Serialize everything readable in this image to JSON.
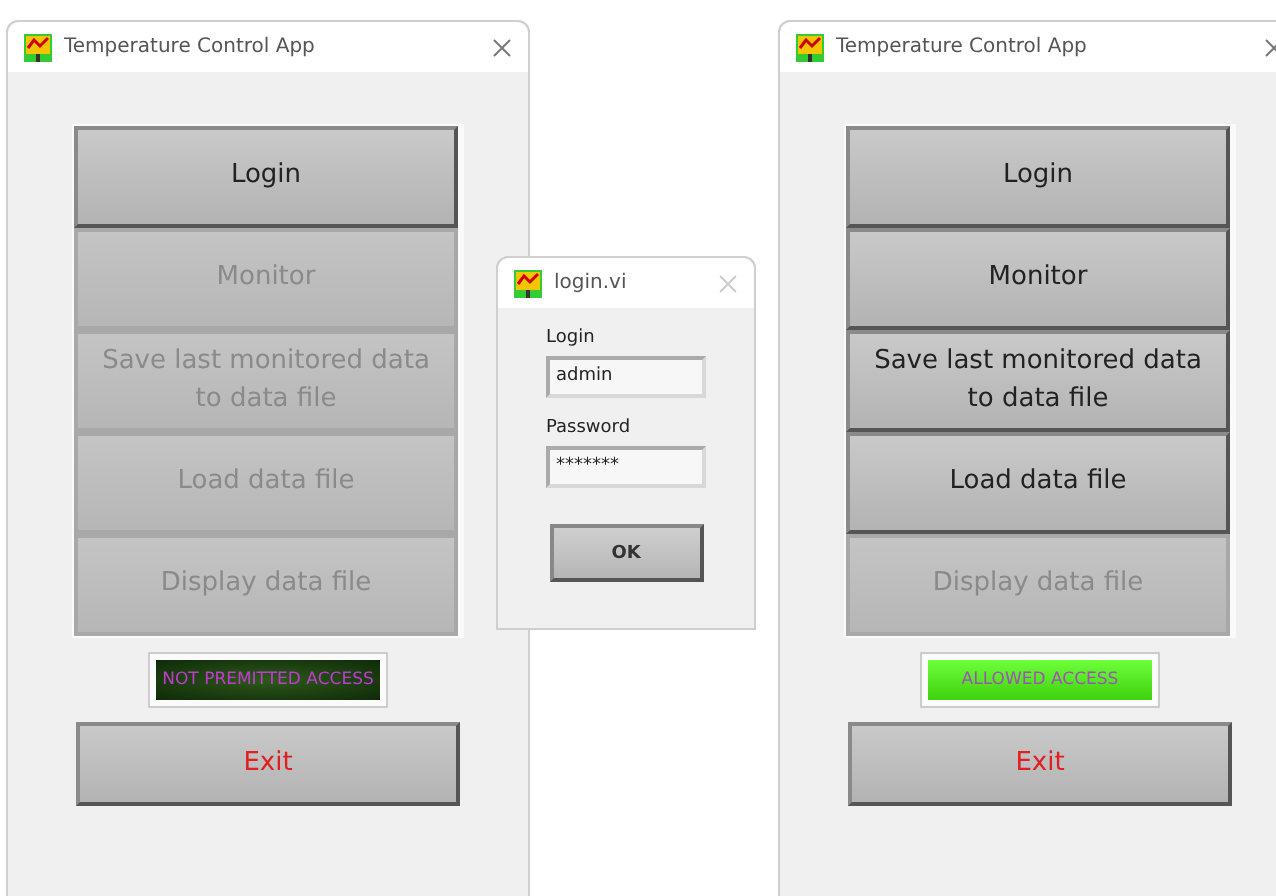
{
  "windows": [
    {
      "kind": "main",
      "title": "Temperature Control App",
      "buttons": [
        {
          "label": "Login",
          "disabled": false
        },
        {
          "label": "Monitor",
          "disabled": true
        },
        {
          "label": "Save last monitored data to data file",
          "disabled": true
        },
        {
          "label": "Load data file",
          "disabled": true
        },
        {
          "label": "Display data file",
          "disabled": true
        }
      ],
      "status": {
        "text": "NOT PREMITTED ACCESS",
        "allowed": false
      },
      "exit_button": "Exit"
    },
    {
      "kind": "dialog",
      "title": "login.vi",
      "fields": [
        {
          "label": "Login",
          "value": "admin"
        },
        {
          "label": "Password",
          "value": "*******"
        }
      ],
      "ok_button": "OK"
    },
    {
      "kind": "main",
      "title": "Temperature Control App",
      "buttons": [
        {
          "label": "Login",
          "disabled": false
        },
        {
          "label": "Monitor",
          "disabled": false
        },
        {
          "label": "Save last monitored data to data file",
          "disabled": false
        },
        {
          "label": "Load data file",
          "disabled": false
        },
        {
          "label": "Display data file",
          "disabled": true
        }
      ],
      "status": {
        "text": "ALLOWED ACCESS",
        "allowed": true
      },
      "exit_button": "Exit"
    }
  ]
}
